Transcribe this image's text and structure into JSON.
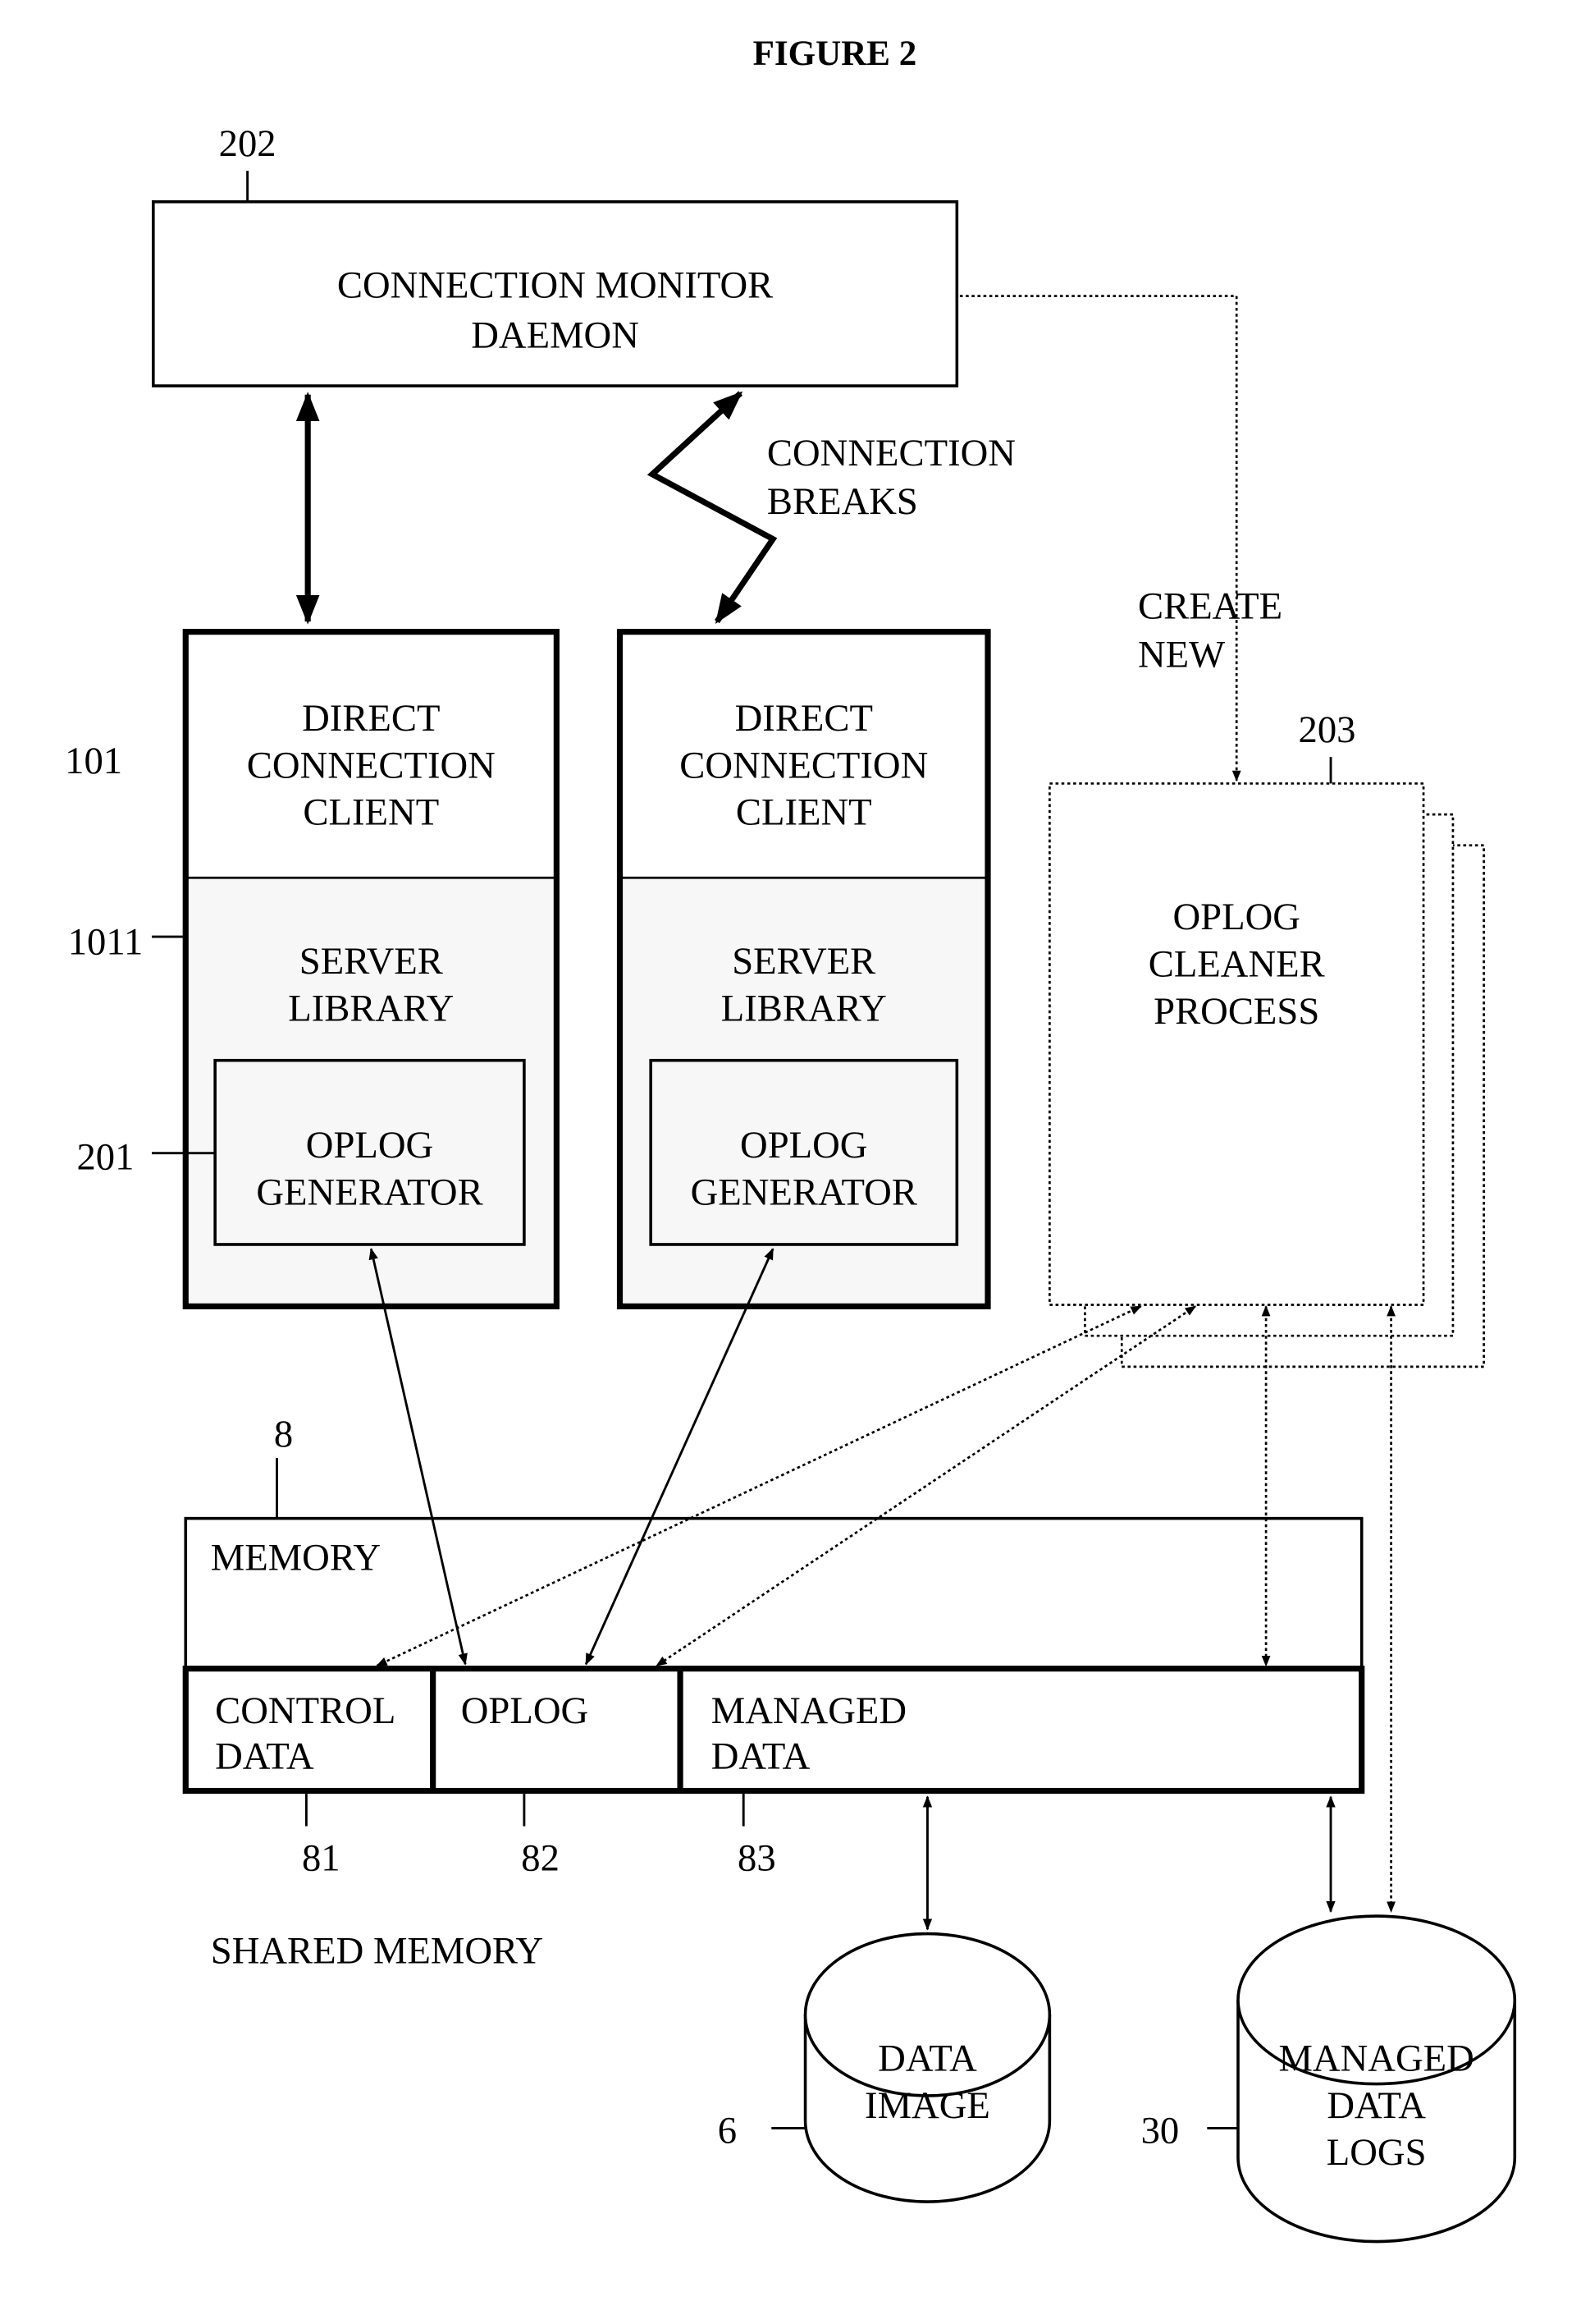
{
  "figure": {
    "title": "FIGURE 2"
  },
  "daemon": {
    "ref": "202",
    "line1": "CONNECTION MONITOR",
    "line2": "DAEMON"
  },
  "connection_breaks": {
    "line1": "CONNECTION",
    "line2": "BREAKS"
  },
  "create_new": {
    "line1": "CREATE",
    "line2": "NEW"
  },
  "client_left": {
    "ref": "101",
    "client_line1": "DIRECT",
    "client_line2": "CONNECTION",
    "client_line3": "CLIENT",
    "library_ref": "1011",
    "library_line1": "SERVER",
    "library_line2": "LIBRARY",
    "generator_ref": "201",
    "generator_line1": "OPLOG",
    "generator_line2": "GENERATOR"
  },
  "client_right": {
    "client_line1": "DIRECT",
    "client_line2": "CONNECTION",
    "client_line3": "CLIENT",
    "library_line1": "SERVER",
    "library_line2": "LIBRARY",
    "generator_line1": "OPLOG",
    "generator_line2": "GENERATOR"
  },
  "cleaner": {
    "ref": "203",
    "line1": "OPLOG",
    "line2": "CLEANER",
    "line3": "PROCESS"
  },
  "memory": {
    "ref": "8",
    "label": "MEMORY",
    "shared_label": "SHARED MEMORY",
    "segments": [
      {
        "ref": "81",
        "line1": "CONTROL",
        "line2": "DATA"
      },
      {
        "ref": "82",
        "line1": "OPLOG",
        "line2": ""
      },
      {
        "ref": "83",
        "line1": "MANAGED",
        "line2": "DATA"
      }
    ]
  },
  "storage": [
    {
      "ref": "6",
      "line1": "DATA",
      "line2": "IMAGE",
      "line3": ""
    },
    {
      "ref": "30",
      "line1": "MANAGED",
      "line2": "DATA",
      "line3": "LOGS"
    }
  ]
}
